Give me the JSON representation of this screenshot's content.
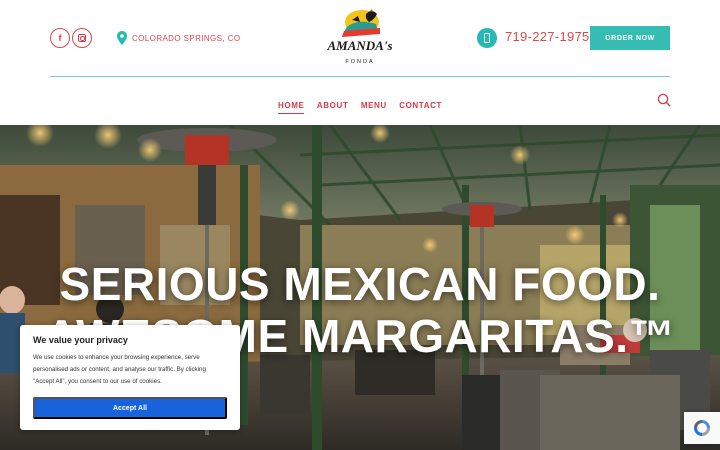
{
  "header": {
    "social": [
      {
        "name": "facebook-icon",
        "glyph": "f"
      },
      {
        "name": "instagram-icon",
        "glyph": ""
      }
    ],
    "location": "COLORADO SPRINGS, CO",
    "logo": {
      "name": "AMANDA's",
      "sub": "FONDA"
    },
    "phone": "719-227-1975",
    "order_label": "ORDER NOW"
  },
  "nav": {
    "items": [
      {
        "label": "HOME",
        "active": true
      },
      {
        "label": "ABOUT",
        "active": false
      },
      {
        "label": "MENU",
        "active": false
      },
      {
        "label": "CONTACT",
        "active": false
      }
    ]
  },
  "hero": {
    "line1": "SERIOUS MEXICAN FOOD.",
    "line2": "AWESOME MARGARITAS.™"
  },
  "cookie": {
    "title": "We value your privacy",
    "text": "We use cookies to enhance your browsing experience, serve personalised ads or content, and analyse our traffic. By clicking \"Accept All\", you consent to our use of cookies.",
    "accept_label": "Accept All"
  },
  "colors": {
    "accent_red": "#e0474c",
    "accent_teal": "#36bdb3",
    "accept_blue": "#1863dc"
  }
}
